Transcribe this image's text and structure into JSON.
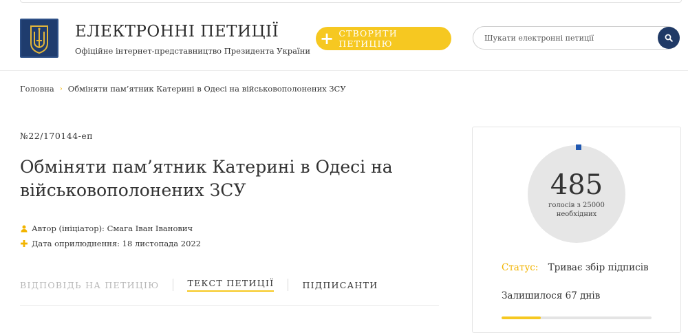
{
  "header": {
    "site_title": "ЕЛЕКТРОННІ ПЕТИЦІЇ",
    "site_subtitle": "Офіційне інтернет-представництво Президента України",
    "logo_icon": "trident-coat-of-arms-icon",
    "create_button_label": "СТВОРИТИ ПЕТИЦІЮ",
    "create_button_icon": "plus-icon",
    "search_placeholder": "Шукати електронні петиції",
    "search_value": "",
    "search_icon": "search-icon"
  },
  "breadcrumb": {
    "home": "Головна",
    "current": "Обміняти пам’ятник Катерині в Одесі на військовополонених ЗСУ"
  },
  "petition": {
    "number": "№22/170144-еп",
    "title": "Обміняти пам’ятник Катерині в Одесі на військовополонених ЗСУ",
    "author": "Автор (ініціатор): Смага Іван Іванович",
    "date": "Дата оприлюднення: 18 листопада 2022"
  },
  "tabs": [
    {
      "label": "ВІДПОВІДЬ НА ПЕТИЦІЮ",
      "state": "disabled"
    },
    {
      "label": "ТЕКСТ ПЕТИЦІЇ",
      "state": "active"
    },
    {
      "label": "ПІДПИСАНТИ",
      "state": "normal"
    }
  ],
  "signatures": {
    "count": "485",
    "caption_line1": "голосів з 25000",
    "caption_line2": "необхідних",
    "status_label": "Статус:",
    "status_value": "Триває збір підписів",
    "remaining": "Залишилося 67 днів",
    "days_progress_fraction": 0.26
  },
  "colors": {
    "accent_yellow": "#f6c821",
    "navy": "#203a66",
    "progress_blue": "#1f57b0"
  }
}
